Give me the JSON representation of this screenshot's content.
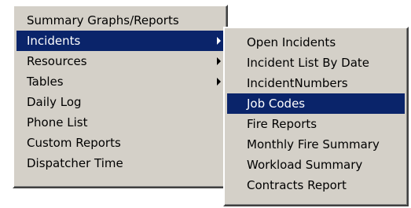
{
  "main_menu": {
    "items": [
      {
        "label": "Summary Graphs/Reports",
        "has_submenu": false,
        "highlighted": false
      },
      {
        "label": "Incidents",
        "has_submenu": true,
        "highlighted": true
      },
      {
        "label": "Resources",
        "has_submenu": true,
        "highlighted": false
      },
      {
        "label": "Tables",
        "has_submenu": true,
        "highlighted": false
      },
      {
        "label": "Daily Log",
        "has_submenu": false,
        "highlighted": false
      },
      {
        "label": "Phone List",
        "has_submenu": false,
        "highlighted": false
      },
      {
        "label": "Custom Reports",
        "has_submenu": false,
        "highlighted": false
      },
      {
        "label": "Dispatcher Time",
        "has_submenu": false,
        "highlighted": false
      }
    ]
  },
  "sub_menu": {
    "items": [
      {
        "label": "Open Incidents",
        "highlighted": false
      },
      {
        "label": "Incident List By Date",
        "highlighted": false
      },
      {
        "label": "IncidentNumbers",
        "highlighted": false
      },
      {
        "label": "Job Codes",
        "highlighted": true
      },
      {
        "label": "Fire Reports",
        "highlighted": false
      },
      {
        "label": "Monthly Fire Summary",
        "highlighted": false
      },
      {
        "label": "Workload Summary",
        "highlighted": false
      },
      {
        "label": "Contracts Report",
        "highlighted": false
      }
    ]
  },
  "colors": {
    "menu_background": "#d4d0c8",
    "highlight_background": "#0a246a",
    "highlight_text": "#ffffff"
  }
}
